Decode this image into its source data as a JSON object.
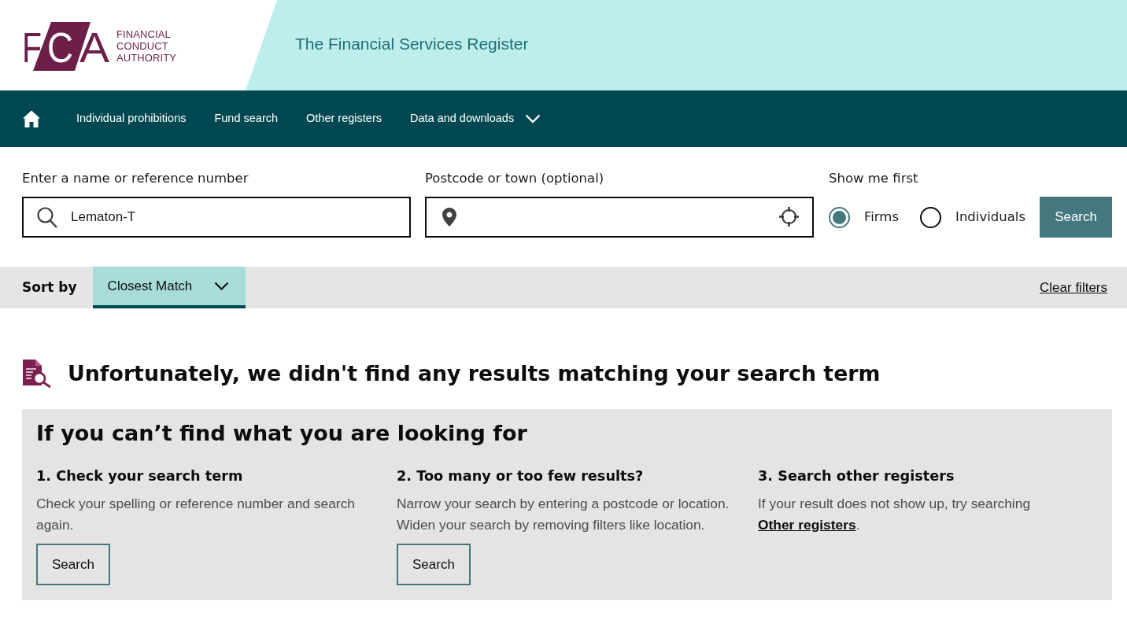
{
  "header": {
    "logo": {
      "letters": [
        "F",
        "C",
        "A"
      ],
      "name": "FINANCIAL CONDUCT AUTHORITY"
    },
    "title": "The Financial Services Register"
  },
  "nav": {
    "items": [
      {
        "kind": "home"
      },
      {
        "kind": "link",
        "label": "Individual prohibitions"
      },
      {
        "kind": "link",
        "label": "Fund search"
      },
      {
        "kind": "link",
        "label": "Other registers"
      },
      {
        "kind": "dropdown",
        "label": "Data and downloads"
      }
    ]
  },
  "search": {
    "name_field": {
      "label": "Enter a name or reference number",
      "value": "Lematon-T"
    },
    "location_field": {
      "label": "Postcode or town (optional)"
    },
    "show_me_first": {
      "label": "Show me first",
      "options": [
        {
          "label": "Firms",
          "selected": true
        },
        {
          "label": "Individuals",
          "selected": false
        }
      ]
    },
    "button": "Search"
  },
  "sort_bar": {
    "label": "Sort by",
    "value": "Closest Match",
    "clear": "Clear filters"
  },
  "results": {
    "message": "Unfortunately, we didn't find any results matching your search term"
  },
  "help": {
    "title": "If you can’t find what you are looking for",
    "columns": [
      {
        "kind": "button",
        "heading": "1. Check your search term",
        "text": "Check your spelling or reference number and search again.",
        "button": "Search"
      },
      {
        "kind": "button",
        "heading": "2. Too many or too few results?",
        "text": "Narrow your search by entering a postcode or location. Widen your search by removing filters like location.",
        "button": "Search"
      },
      {
        "kind": "link",
        "heading": "3. Search other registers",
        "text": "If your result does not show up, try searching",
        "link": "Other registers",
        "text_after": "."
      }
    ]
  }
}
